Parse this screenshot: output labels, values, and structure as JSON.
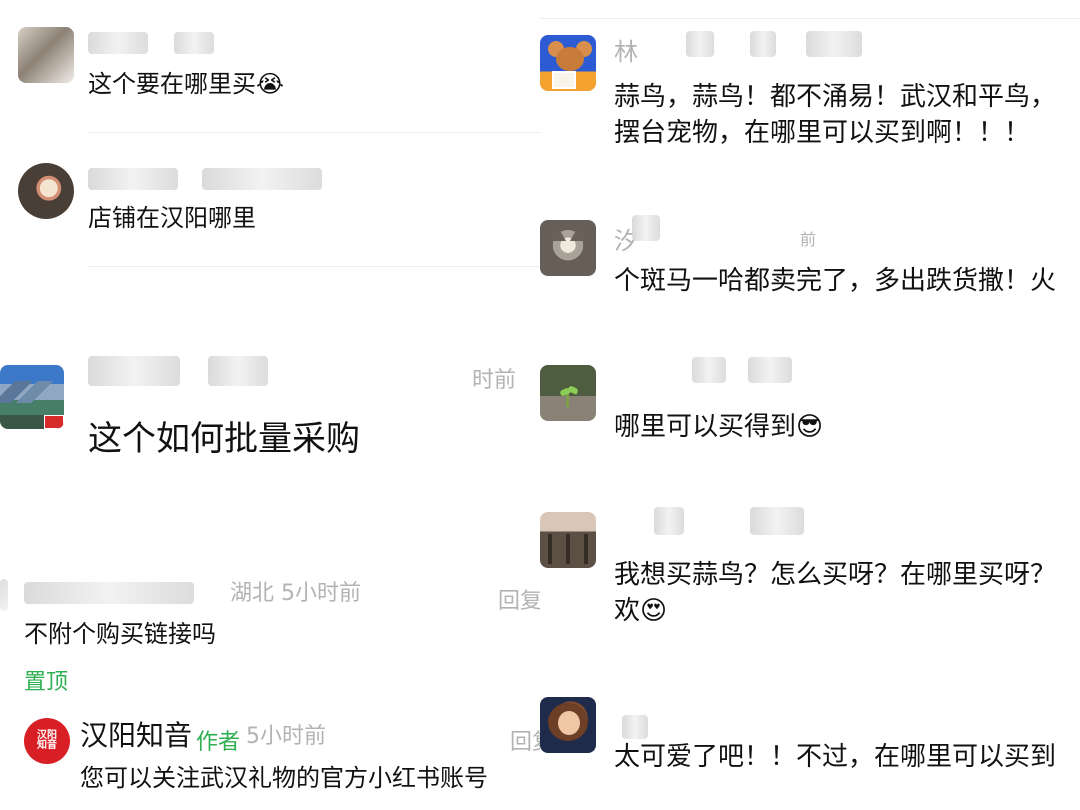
{
  "left_column": {
    "items": [
      {
        "meta": "",
        "text": "这个要在哪里买😭"
      },
      {
        "meta": "",
        "text": "店铺在汉阳哪里"
      },
      {
        "meta": "时前",
        "text": "这个如何批量采购"
      },
      {
        "meta": "湖北 5小时前",
        "text": "不附个购买链接吗",
        "reply_label": "回复",
        "pin_label": "置顶"
      },
      {
        "name": "汉阳知音",
        "author_label": "作者",
        "time": "5小时前",
        "reply_label": "回复",
        "text": "您可以关注武汉礼物的官方小红书账号",
        "avatar_text": "汉阳\n知音"
      }
    ]
  },
  "right_column": {
    "items": [
      {
        "initial": "林",
        "text_line1": "蒜鸟，蒜鸟！都不涌易！武汉和平鸟，",
        "text_line2": "摆台宠物，在哪里可以买到啊！！！"
      },
      {
        "initial": "汐",
        "meta": "前",
        "text": "个斑马一哈都卖完了，多出跌货撒！火"
      },
      {
        "text": "哪里可以买得到😎"
      },
      {
        "text_line1": "我想买蒜鸟？怎么买呀？在哪里买呀？",
        "text_line2": "欢😍"
      },
      {
        "text": "太可爱了吧！！不过，在哪里可以买到"
      }
    ]
  }
}
